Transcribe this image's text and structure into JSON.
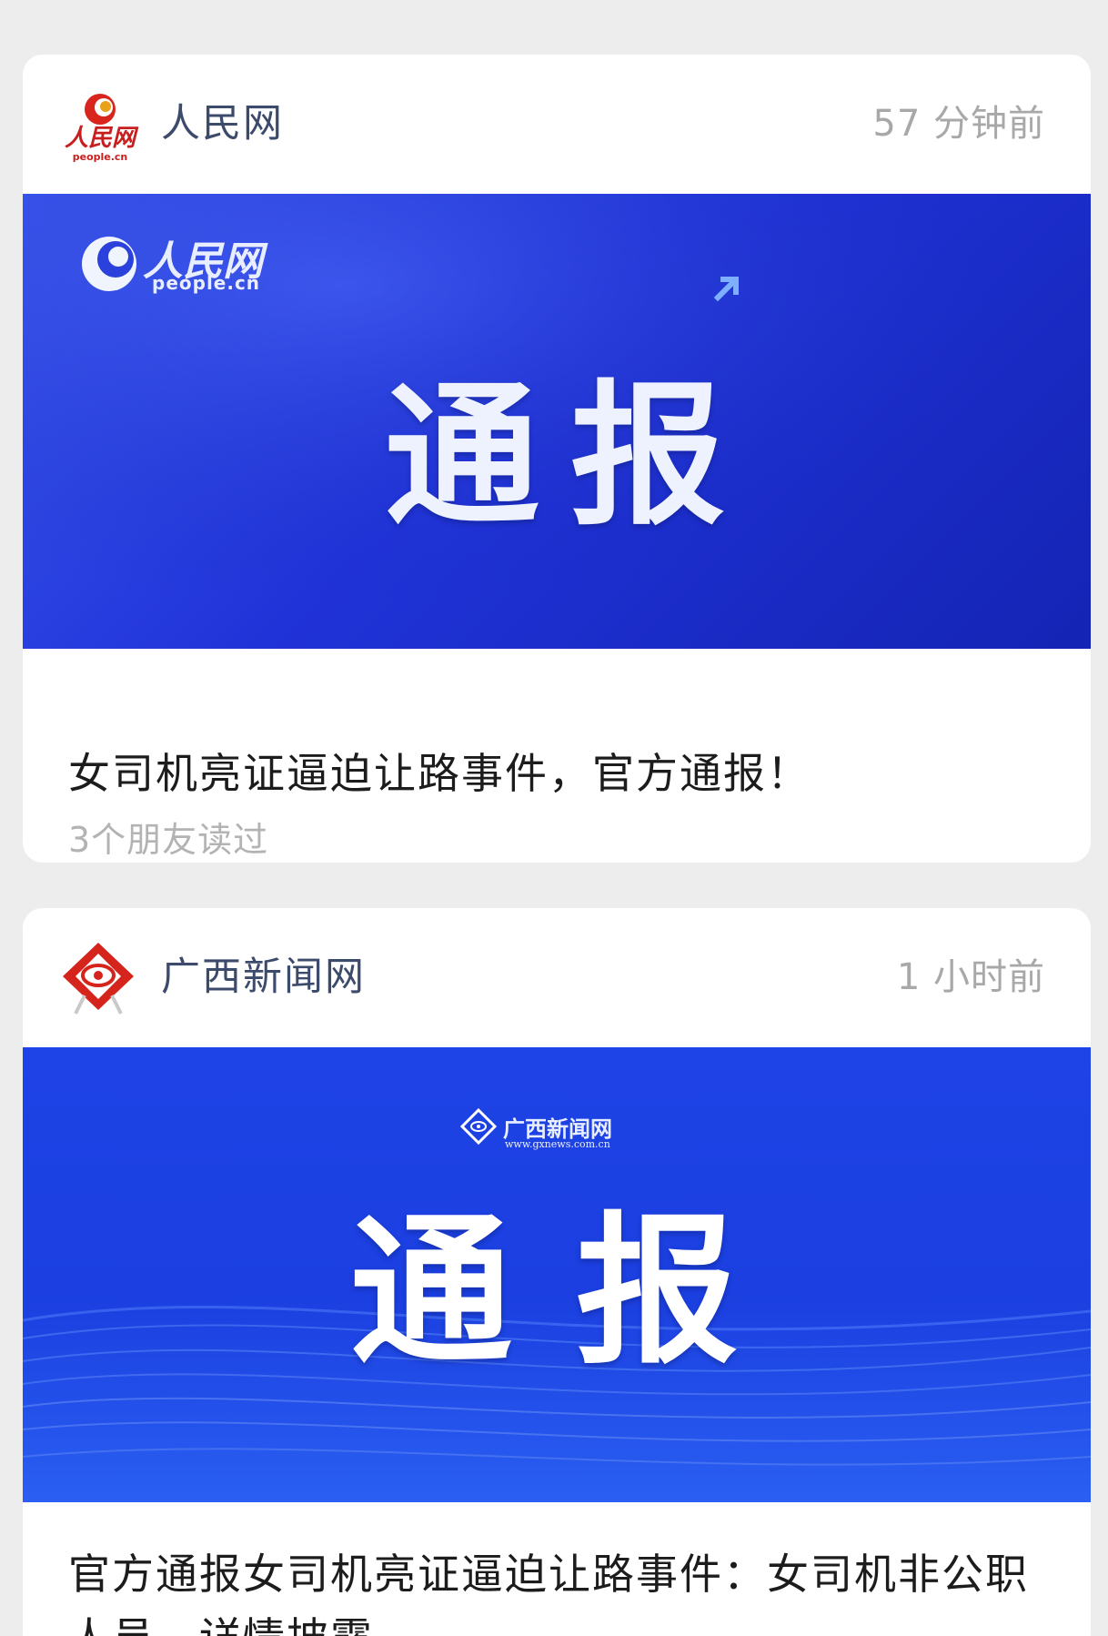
{
  "feed": {
    "cards": [
      {
        "source_name": "人民网",
        "time": "57 分钟前",
        "source_logo_icon": "people-daily-logo-icon",
        "cover": {
          "logo_cn": "人民网",
          "logo_en": "people.cn",
          "headline": "通报"
        },
        "title": "女司机亮证逼迫让路事件，官方通报！",
        "read_count": "3个朋友读过"
      },
      {
        "source_name": "广西新闻网",
        "time": "1 小时前",
        "source_logo_icon": "gxnews-logo-icon",
        "cover": {
          "logo_cn": "广西新闻网",
          "logo_en": "www.gxnews.com.cn",
          "headline": "通报"
        },
        "title": "官方通报女司机亮证逼迫让路事件：女司机非公职人员，详情披露"
      }
    ]
  },
  "colors": {
    "background": "#ededed",
    "card": "#ffffff",
    "source_name": "#3c4a6b",
    "time": "#a8a8a8",
    "title": "#1c1c1c",
    "read_count": "#b3b3b3",
    "cover_blue": "#2033d8"
  }
}
